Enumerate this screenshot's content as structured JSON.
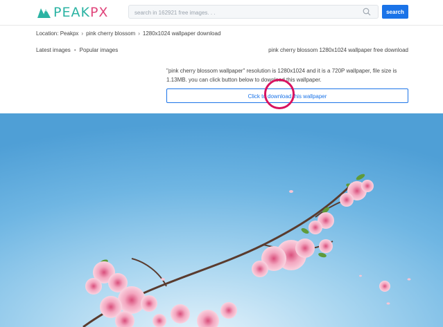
{
  "brand": {
    "logo_text_pe": "PE",
    "logo_text_ak": "AK",
    "logo_text_px": "PX",
    "teal": "#2bb3a3",
    "pink": "#e0457b",
    "accent": "#1a73e8"
  },
  "search": {
    "placeholder": "search in 162921 free images. . .",
    "button_label": "search",
    "icon": "search-icon"
  },
  "breadcrumb": {
    "label": "Location:",
    "items": [
      "Peakpx",
      "pink cherry blossom",
      "1280x1024 wallpaper download"
    ],
    "separator": "›"
  },
  "subnav": {
    "latest": "Latest images",
    "dot": "•",
    "popular": "Popular images",
    "right_title": "pink cherry blossom 1280x1024 wallpaper free download"
  },
  "description": "\"pink cherry blossom wallpaper\" resolution is 1280x1024 and it is a 720P wallpaper, file size is 1.13MB. you can click button below to download this wallpaper.",
  "download_button": "Click to download this wallpaper",
  "click_marker_color": "#d8125f"
}
